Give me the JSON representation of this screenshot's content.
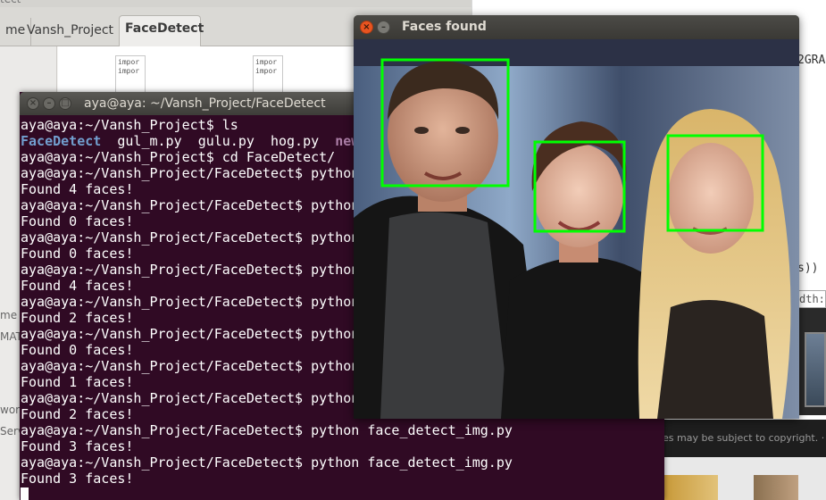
{
  "file_manager": {
    "top_fragment": "tect",
    "tabs": [
      {
        "label": "me",
        "active": false
      },
      {
        "label": "Vansh_Project",
        "active": false
      },
      {
        "label": "FaceDetect",
        "active": true
      }
    ],
    "file_icon_lines": [
      [
        "impor",
        "impor"
      ],
      [
        "impor",
        "",
        "impor"
      ]
    ],
    "sidebar_fragments": [
      "me",
      "MAT",
      "wor",
      "Serv"
    ]
  },
  "browser": {
    "code_fragment_1": "2GRA",
    "code_fragment_2": "s))",
    "width_label": "dth:",
    "copyright_text": "es may be subject to copyright. · Ser"
  },
  "terminal": {
    "title": "aya@aya: ~/Vansh_Project/FaceDetect",
    "lines": [
      {
        "prompt": "aya@aya:~/Vansh_Project$ ",
        "cmd": "ls"
      },
      {
        "files": [
          "FaceDetect",
          "gul_m.py",
          "gulu.py",
          "hog.py",
          "new"
        ]
      },
      {
        "prompt": "aya@aya:~/Vansh_Project$ ",
        "cmd": "cd FaceDetect/"
      },
      {
        "prompt": "aya@aya:~/Vansh_Project/FaceDetect$ ",
        "cmd": "python"
      },
      {
        "out": "Found 4 faces!"
      },
      {
        "prompt": "aya@aya:~/Vansh_Project/FaceDetect$ ",
        "cmd": "python"
      },
      {
        "out": "Found 0 faces!"
      },
      {
        "prompt": "aya@aya:~/Vansh_Project/FaceDetect$ ",
        "cmd": "python"
      },
      {
        "out": "Found 0 faces!"
      },
      {
        "prompt": "aya@aya:~/Vansh_Project/FaceDetect$ ",
        "cmd": "python"
      },
      {
        "out": "Found 4 faces!"
      },
      {
        "prompt": "aya@aya:~/Vansh_Project/FaceDetect$ ",
        "cmd": "python"
      },
      {
        "out": "Found 2 faces!"
      },
      {
        "prompt": "aya@aya:~/Vansh_Project/FaceDetect$ ",
        "cmd": "python"
      },
      {
        "out": "Found 0 faces!"
      },
      {
        "prompt": "aya@aya:~/Vansh_Project/FaceDetect$ ",
        "cmd": "python"
      },
      {
        "out": "Found 1 faces!"
      },
      {
        "prompt": "aya@aya:~/Vansh_Project/FaceDetect$ ",
        "cmd": "python"
      },
      {
        "out": "Found 2 faces!"
      },
      {
        "prompt": "aya@aya:~/Vansh_Project/FaceDetect$ ",
        "cmd": "python face_detect_img.py"
      },
      {
        "out": "Found 3 faces!"
      },
      {
        "prompt": "aya@aya:~/Vansh_Project/FaceDetect$ ",
        "cmd": "python face_detect_img.py"
      },
      {
        "out": "Found 3 faces!"
      }
    ]
  },
  "faces_window": {
    "title": "Faces found",
    "box_color": "#00ff00",
    "detected_faces": 3
  },
  "colors": {
    "terminal_bg": "#300a24",
    "directory": "#729fcf",
    "close_button": "#e95420"
  }
}
